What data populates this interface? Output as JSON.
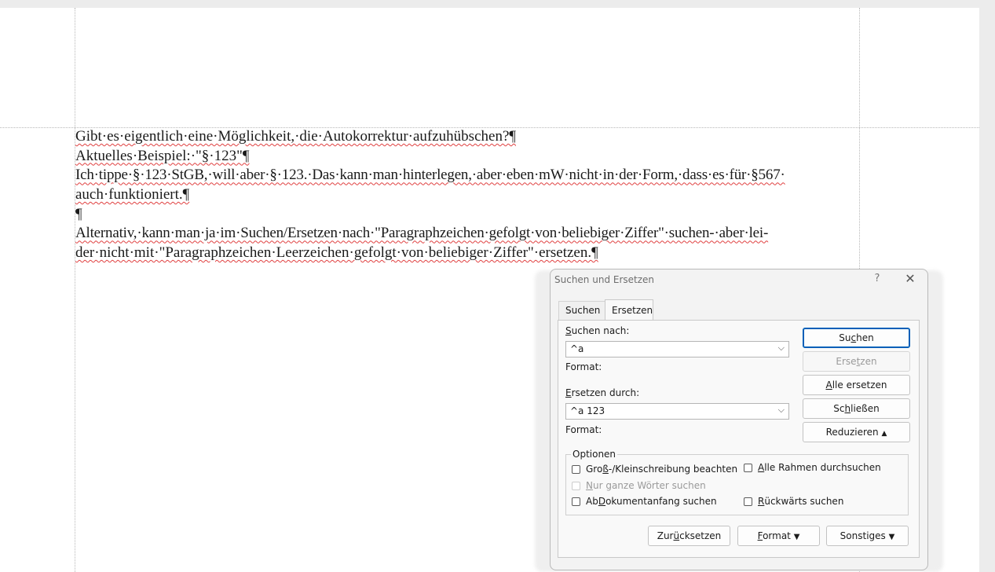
{
  "document": {
    "lines": [
      "Gibt·es·eigentlich·eine·Möglichkeit,·die·Autokorrektur·aufzuhübschen?¶",
      "Aktuelles·Beispiel:·\"§·123\"¶",
      "Ich·tippe·§·123·StGB,·will·aber·§·123.·Das·kann·man·hinterlegen,·aber·eben·mW·nicht·in·der·Form,·dass·es·für·§567·",
      "auch·funktioniert.¶",
      "¶",
      "Alternativ,·kann·man·ja·im·Suchen/Ersetzen·nach·\"Paragraphzeichen·gefolgt·von·beliebiger·Ziffer\"·suchen-·aber·lei-",
      "der·nicht·mit·\"Paragraphzeichen·Leerzeichen·gefolgt·von·beliebiger·Ziffer\"·ersetzen.¶"
    ]
  },
  "dialog": {
    "title": "Suchen und Ersetzen",
    "help": "?",
    "close": "✕",
    "tabs": [
      "Suchen",
      "Ersetzen"
    ],
    "find_label_u": "S",
    "find_label_rest": "uchen nach:",
    "find_value": "^a",
    "format1_label": "Format:",
    "replace_label_u": "E",
    "replace_label_rest": "rsetzen durch:",
    "replace_value": "^a 123",
    "format2_label": "Format:",
    "buttons": {
      "find_a": "Su",
      "find_u": "c",
      "find_b": "hen",
      "replace_a": "Erse",
      "replace_u": "t",
      "replace_b": "zen",
      "replace_all_a": "",
      "replace_all_u": "A",
      "replace_all_b": "lle ersetzen",
      "close_a": "Sc",
      "close_u": "h",
      "close_b": "ließen",
      "reduce": "Reduzieren"
    },
    "options": {
      "legend": "Optionen",
      "match_case_a": "Gro",
      "match_case_u": "ß",
      "match_case_b": "-/Kleinschreibung beachten",
      "whole_words_u": "N",
      "whole_words_b": "ur ganze Wörter suchen",
      "from_start_a": "Ab ",
      "from_start_u": "D",
      "from_start_b": "okumentanfang suchen",
      "all_frames_u": "A",
      "all_frames_b": "lle Rahmen durchsuchen",
      "backwards_u": "R",
      "backwards_b": "ückwärts suchen"
    },
    "bottom_buttons": {
      "reset_a": "Zur",
      "reset_u": "ü",
      "reset_b": "cksetzen",
      "format_u": "F",
      "format_b": "ormat",
      "other": "Sonstiges"
    }
  }
}
